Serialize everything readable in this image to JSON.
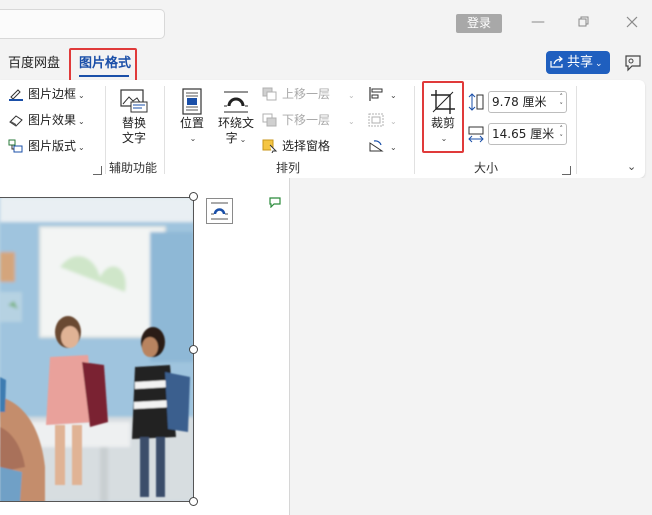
{
  "titlebar": {
    "login_label": "登录",
    "minimize_icon": "minimize-icon",
    "restore_icon": "restore-icon",
    "close_icon": "close-icon"
  },
  "tabs": [
    {
      "label": "百度网盘",
      "active": false
    },
    {
      "label": "图片格式",
      "active": true
    }
  ],
  "share": {
    "label": "共享"
  },
  "ribbon": {
    "picture_styles": {
      "items": [
        {
          "label": "图片边框",
          "icon": "border-pen-icon"
        },
        {
          "label": "图片效果",
          "icon": "effects-icon"
        },
        {
          "label": "图片版式",
          "icon": "layout-icon"
        }
      ]
    },
    "accessibility": {
      "alt_text_label_line1": "替换",
      "alt_text_label_line2": "文字",
      "group_label": "辅助功能"
    },
    "arrange": {
      "position_label": "位置",
      "wrap_label_line1": "环绕文",
      "wrap_label_line2": "字",
      "bring_forward_label": "上移一层",
      "send_backward_label": "下移一层",
      "selection_pane_label": "选择窗格",
      "group_label": "排列"
    },
    "size": {
      "crop_label": "裁剪",
      "height_value": "9.78 厘米",
      "width_value": "14.65 厘米",
      "group_label": "大小"
    }
  },
  "colors": {
    "accent": "#1a4fa8",
    "share_button": "#1f5fbf",
    "highlight_box": "#e03a3a",
    "login_button": "#a8a8a8"
  }
}
